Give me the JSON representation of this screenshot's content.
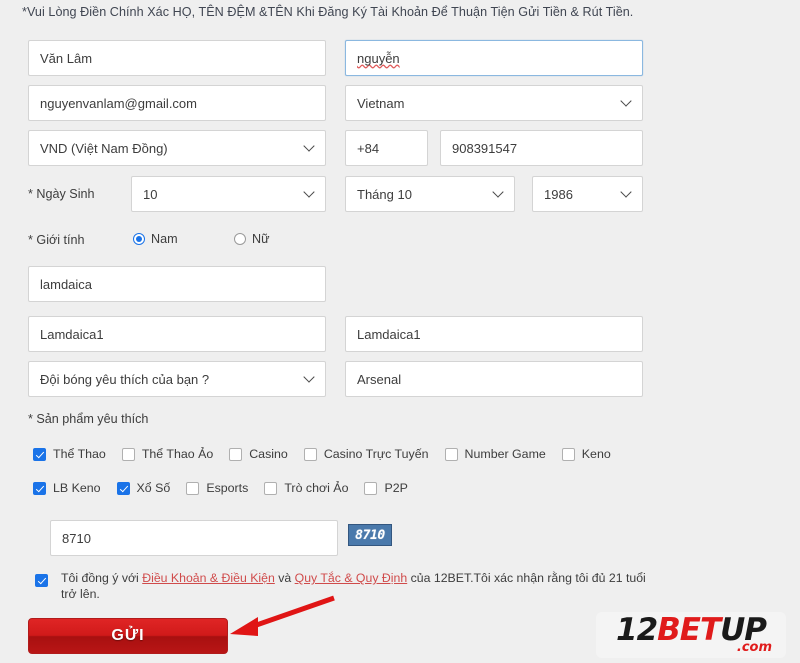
{
  "notice": {
    "text": "*Vui Lòng Điền Chính Xác HỌ, TÊN ĐỆM &TÊN Khi Đăng Ký Tài Khoản Để Thuận Tiện Gửi Tiền & Rút Tiền."
  },
  "form": {
    "last_name": {
      "label": "",
      "value": "Văn Lâm"
    },
    "first_name": {
      "label": "",
      "value": "nguyễn"
    },
    "email": {
      "label": "",
      "value": "nguyenvanlam@gmail.com"
    },
    "country": {
      "label": "",
      "value": "Vietnam"
    },
    "currency": {
      "label": "",
      "value": "VND (Việt Nam Đồng)"
    },
    "phone_code": {
      "label": "",
      "value": "+84"
    },
    "phone_number": {
      "label": "",
      "value": "908391547"
    },
    "dob": {
      "label": "* Ngày Sinh",
      "day": "10",
      "month": "Tháng 10",
      "year": "1986"
    },
    "gender": {
      "label": "* Giới tính",
      "options": [
        {
          "label": "Nam",
          "selected": true
        },
        {
          "label": "Nữ",
          "selected": false
        }
      ]
    },
    "username": {
      "label": "",
      "value": "lamdaica"
    },
    "password": {
      "label": "",
      "value": "Lamdaica1"
    },
    "confirm_password": {
      "label": "",
      "value": "Lamdaica1"
    },
    "security_question": {
      "label": "",
      "value": "Đội bóng yêu thích của bạn ?"
    },
    "security_answer": {
      "label": "",
      "value": "Arsenal"
    }
  },
  "products": {
    "label": "* Sản phẩm yêu thích",
    "row1": [
      {
        "label": "Thể Thao",
        "checked": true
      },
      {
        "label": "Thể Thao Ảo",
        "checked": false
      },
      {
        "label": "Casino",
        "checked": false
      },
      {
        "label": "Casino Trực Tuyến",
        "checked": false
      },
      {
        "label": "Number Game",
        "checked": false
      },
      {
        "label": "Keno",
        "checked": false
      }
    ],
    "row2": [
      {
        "label": "LB Keno",
        "checked": true
      },
      {
        "label": "Xổ Số",
        "checked": true
      },
      {
        "label": "Esports",
        "checked": false
      },
      {
        "label": "Trò chơi Ảo",
        "checked": false
      },
      {
        "label": "P2P",
        "checked": false
      }
    ]
  },
  "captcha": {
    "input_value": "8710",
    "image_text": "8710"
  },
  "terms": {
    "checked": true,
    "part1": "Tôi đồng ý với ",
    "link1": "Điều Khoản & Điều Kiện",
    "part2": " và ",
    "link2": "Quy Tắc & Quy Định",
    "part3": " của 12BET.Tôi xác nhận rằng tôi đủ 21 tuổi trở lên."
  },
  "submit": {
    "label": "GỬI"
  },
  "logo": {
    "part1": "12",
    "part2": "BET",
    "part3": "UP",
    "dotcom": ".com"
  },
  "colors": {
    "accent_blue": "#1a73e8",
    "submit_red": "#d01a1a",
    "link_red": "#d04b4b",
    "captcha_blue": "#4a79ab",
    "page_bg": "#efefef"
  }
}
